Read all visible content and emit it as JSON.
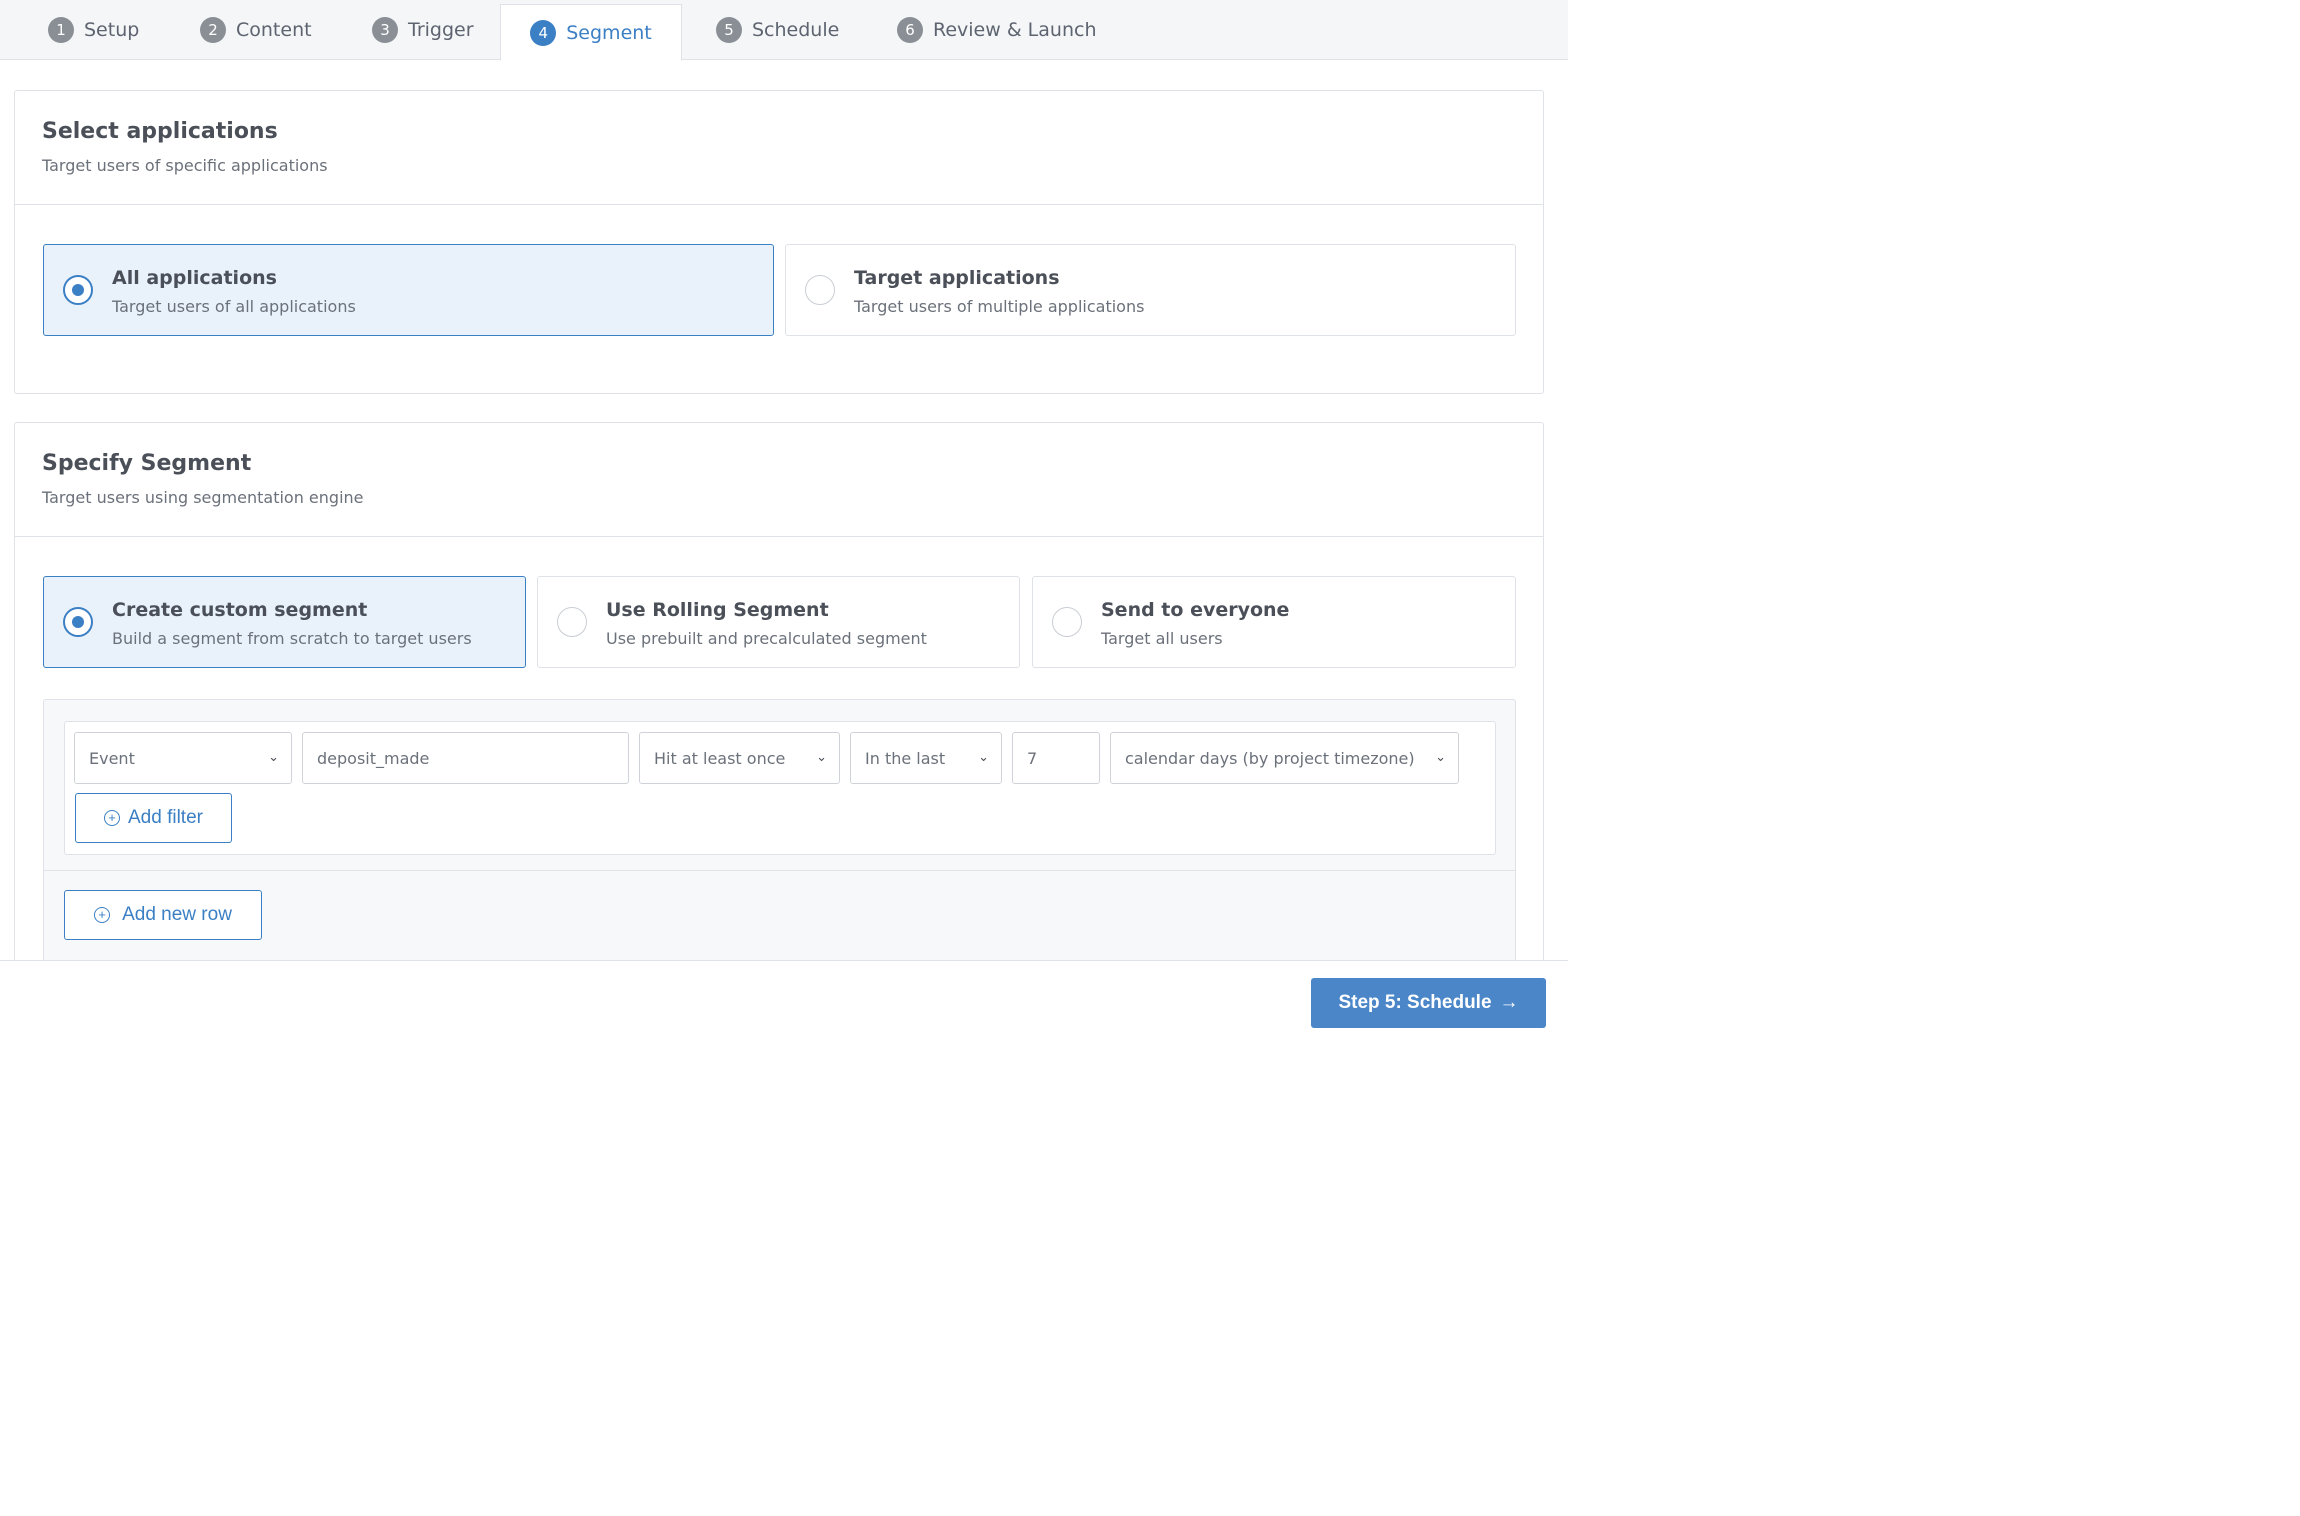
{
  "tabs": [
    {
      "num": "1",
      "label": "Setup"
    },
    {
      "num": "2",
      "label": "Content"
    },
    {
      "num": "3",
      "label": "Trigger"
    },
    {
      "num": "4",
      "label": "Segment"
    },
    {
      "num": "5",
      "label": "Schedule"
    },
    {
      "num": "6",
      "label": "Review & Launch"
    }
  ],
  "active_tab": "Segment",
  "applications": {
    "title": "Select applications",
    "subtitle": "Target users of specific applications",
    "options": [
      {
        "title": "All applications",
        "subtitle": "Target users of all applications",
        "selected": true
      },
      {
        "title": "Target applications",
        "subtitle": "Target users of multiple applications",
        "selected": false
      }
    ]
  },
  "segment": {
    "title": "Specify Segment",
    "subtitle": "Target users using segmentation engine",
    "options": [
      {
        "title": "Create custom segment",
        "subtitle": "Build a segment from scratch to target users",
        "selected": true
      },
      {
        "title": "Use Rolling Segment",
        "subtitle": "Use prebuilt and precalculated segment",
        "selected": false
      },
      {
        "title": "Send to everyone",
        "subtitle": "Target all users",
        "selected": false
      }
    ],
    "filter": {
      "type_value": "Event",
      "event_value": "deposit_made",
      "frequency_value": "Hit at least once",
      "window_value": "In the last",
      "count_value": "7",
      "unit_value": "calendar days (by project timezone)"
    },
    "add_filter_label": "Add filter",
    "add_row_label": "Add new row"
  },
  "footer": {
    "next_label": "Step 5: Schedule",
    "next_icon": "arrow-right-icon"
  },
  "colors": {
    "accent": "#3b7fc4",
    "selected_bg": "#e9f2fb",
    "primary_button": "#4a86c8"
  }
}
